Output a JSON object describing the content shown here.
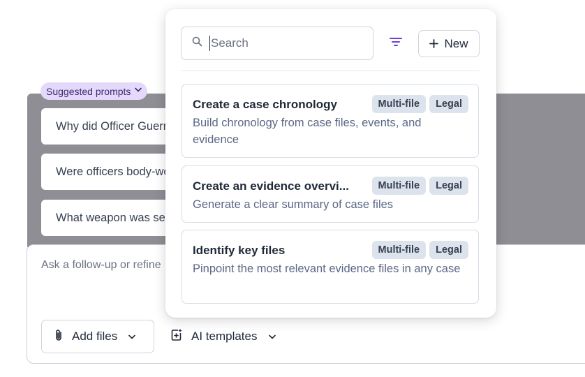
{
  "suggested": {
    "chip_label": "Suggested prompts",
    "prompts": [
      "Why did Officer Guerrero",
      "Were officers body-worn",
      "What weapon was seized"
    ]
  },
  "composer": {
    "placeholder": "Ask a follow-up or refine",
    "add_files_label": "Add files",
    "ai_templates_label": "AI templates"
  },
  "popover": {
    "search_placeholder": "Search",
    "new_label": "New",
    "templates": [
      {
        "title": "Create a case chronology",
        "description": "Build chronology from case files, events, and evidence",
        "tags": [
          "Multi-file",
          "Legal"
        ]
      },
      {
        "title": "Create an evidence overvi...",
        "description": "Generate a clear summary of case files",
        "tags": [
          "Multi-file",
          "Legal"
        ]
      },
      {
        "title": "Identify key files",
        "description": "Pinpoint the most relevant evidence files in any case",
        "tags": [
          "Multi-file",
          "Legal"
        ]
      }
    ]
  },
  "colors": {
    "accent": "#6d3fd9",
    "chip_bg": "#e4d9fb",
    "tag_bg": "#dde3ec",
    "overlay_gray": "#8e8e94"
  },
  "icons": [
    "chevron-down-icon",
    "search-icon",
    "filter-icon",
    "plus-icon",
    "paperclip-icon",
    "ai-template-icon"
  ]
}
